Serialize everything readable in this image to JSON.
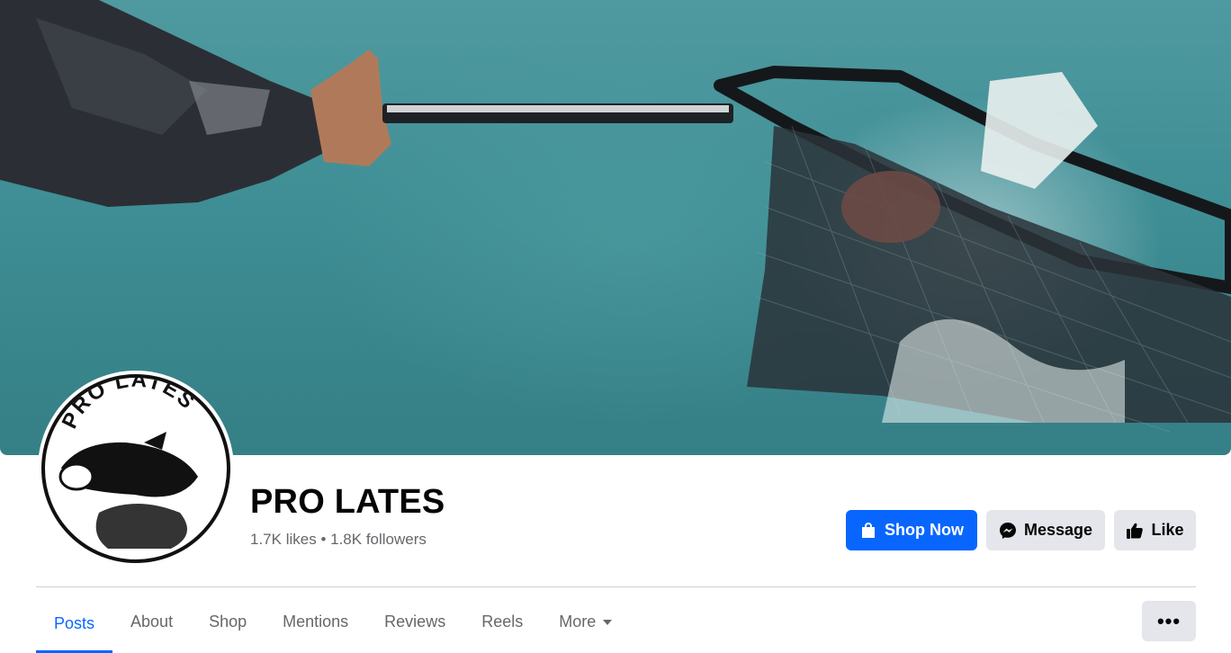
{
  "profile": {
    "name": "PRO LATES",
    "likes": "1.7K likes",
    "separator": "•",
    "followers": "1.8K followers",
    "logo_text": "PRO LATES"
  },
  "actions": {
    "shop_now": "Shop Now",
    "message": "Message",
    "like": "Like"
  },
  "tabs": [
    {
      "label": "Posts",
      "active": true
    },
    {
      "label": "About"
    },
    {
      "label": "Shop"
    },
    {
      "label": "Mentions"
    },
    {
      "label": "Reviews"
    },
    {
      "label": "Reels"
    },
    {
      "label": "More"
    }
  ],
  "more_options": "•••",
  "colors": {
    "accent": "#0866ff",
    "button_secondary": "#e4e6eb",
    "text_secondary": "#65676b",
    "water": "#3f8e95"
  },
  "icons": {
    "shop": "shopping-bag-icon",
    "message": "messenger-icon",
    "like": "thumbs-up-icon",
    "more": "caret-down-icon"
  }
}
